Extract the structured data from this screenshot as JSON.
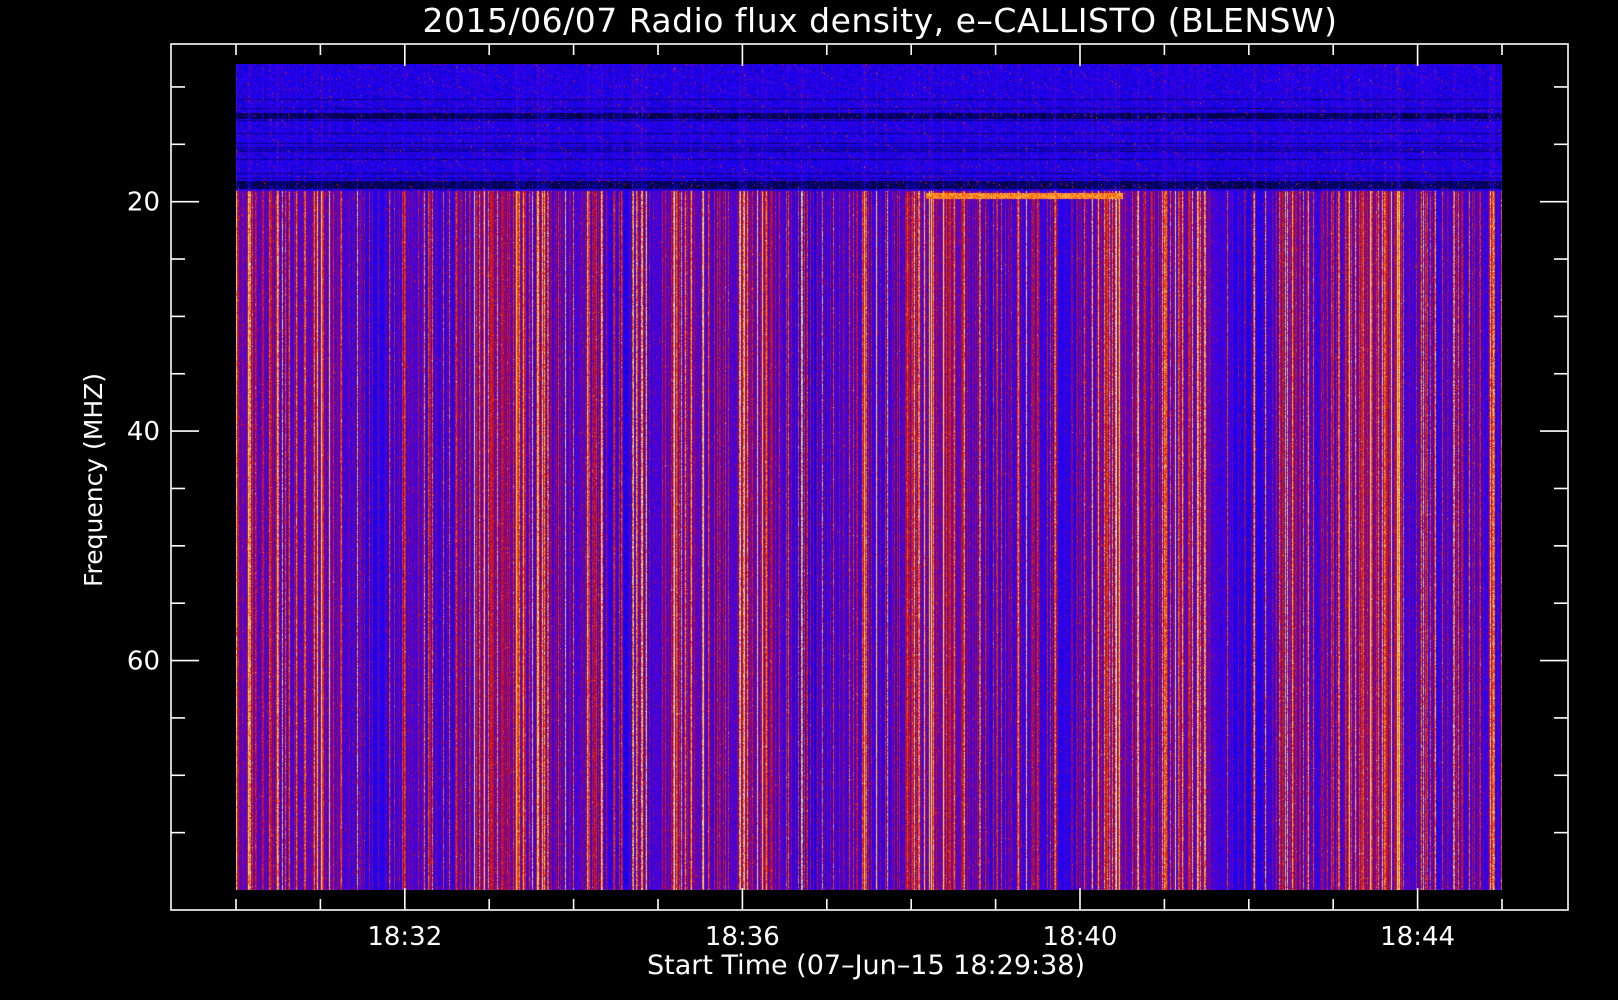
{
  "chart_data": {
    "type": "heatmap",
    "title": "2015/06/07  Radio flux density, e–CALLISTO (BLENSW)",
    "xlabel": "Start Time (07–Jun–15 18:29:38)",
    "ylabel": "Frequency (MHZ)",
    "x_range_minutes": [
      18.3,
      18.45
    ],
    "x_axis": {
      "start": "18:30",
      "end": "18:45",
      "tick_labels": [
        "18:32",
        "18:36",
        "18:40",
        "18:44"
      ],
      "minor_tick_minutes": [
        "18:30",
        "18:31",
        "18:32",
        "18:33",
        "18:34",
        "18:35",
        "18:36",
        "18:37",
        "18:38",
        "18:39",
        "18:40",
        "18:41",
        "18:42",
        "18:43",
        "18:44",
        "18:45"
      ]
    },
    "y_axis": {
      "range": [
        8,
        80
      ],
      "inverted": true,
      "tick_labels": [
        "20",
        "40",
        "60"
      ],
      "major_tick_values": [
        20,
        40,
        60
      ],
      "minor_tick_values": [
        10,
        15,
        25,
        30,
        35,
        45,
        50,
        55,
        65,
        70,
        75
      ]
    },
    "colormap": [
      "#000000",
      "#1000ff",
      "#5a00c8",
      "#c81414",
      "#ff5000",
      "#ffe060"
    ],
    "features": [
      {
        "kind": "band",
        "freq_range_mhz": [
          8,
          19
        ],
        "level": "low-noise mottled blue/black"
      },
      {
        "kind": "interference_line",
        "freq_mhz": 19.5,
        "time_start": "18:38:10",
        "time_end": "18:40:30",
        "level": "high"
      },
      {
        "kind": "vertical_streaks",
        "freq_range_mhz": [
          19,
          80
        ],
        "level": "broadband RFI streaks"
      }
    ]
  }
}
